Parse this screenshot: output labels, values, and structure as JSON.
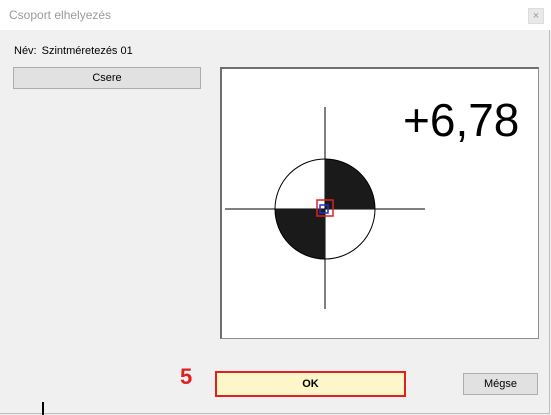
{
  "window": {
    "title": "Csoport elhelyezés",
    "close_label": "×"
  },
  "form": {
    "name_label": "Név:",
    "name_value": "Szintméretezés 01"
  },
  "buttons": {
    "swap": "Csere",
    "ok": "OK",
    "cancel": "Mégse"
  },
  "preview": {
    "elevation_text": "+6,78",
    "symbol": "level-marker-icon"
  },
  "annotation": {
    "step_number": "5"
  },
  "colors": {
    "accent_red": "#e02020",
    "ok_fill": "#fdf6c8"
  }
}
